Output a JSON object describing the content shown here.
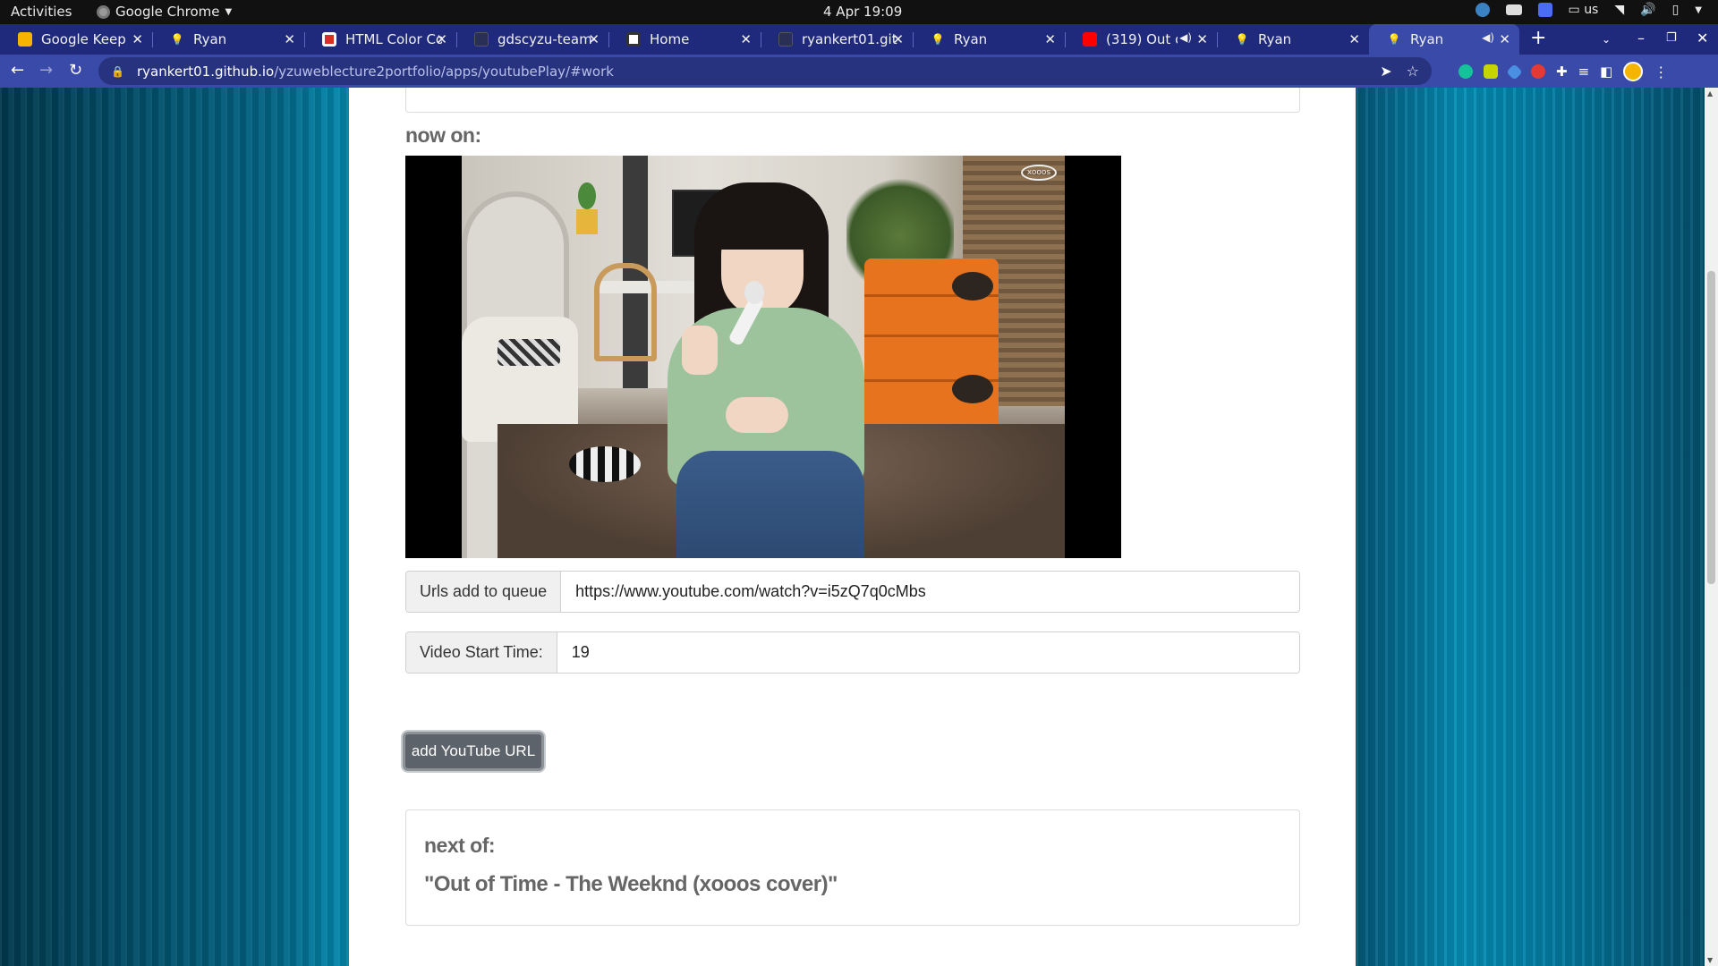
{
  "system_bar": {
    "activities": "Activities",
    "app_name": "Google Chrome",
    "clock": "4 Apr  19:09",
    "keyboard_layout": "us"
  },
  "tabs": [
    {
      "title": "Google Keep",
      "icon": "keep-icon"
    },
    {
      "title": "Ryan",
      "icon": "bulb-icon"
    },
    {
      "title": "HTML Color Co",
      "icon": "color-codes-icon"
    },
    {
      "title": "gdscyzu-team-s",
      "icon": "github-icon"
    },
    {
      "title": "Home",
      "icon": "globe-icon"
    },
    {
      "title": "ryankert01.gith",
      "icon": "github-icon"
    },
    {
      "title": "Ryan",
      "icon": "bulb-icon"
    },
    {
      "title": "(319) Out of",
      "icon": "youtube-icon"
    },
    {
      "title": "Ryan",
      "icon": "bulb-icon"
    },
    {
      "title": "Ryan",
      "icon": "bulb-icon"
    }
  ],
  "address_bar": {
    "host": "ryankert01.github.io",
    "path": "/yzuweblecture2portfolio/apps/youtubePlay/#work"
  },
  "page": {
    "now_on_label": "now on:",
    "queue_input": {
      "label": "Urls add to queue",
      "value": "https://www.youtube.com/watch?v=i5zQ7q0cMbs"
    },
    "start_time_input": {
      "label": "Video Start Time:",
      "value": "19"
    },
    "add_button_label": "add YouTube URL",
    "next_of_label": "next of:",
    "next_title": "\"Out of Time - The Weeknd (xooos cover)\"",
    "video_watermark": "xooos"
  },
  "colors": {
    "tab_strip": "#1f2a7c",
    "active_tab": "#3a4aa8",
    "button": "#5c636a",
    "page_bg": "#03617f"
  }
}
